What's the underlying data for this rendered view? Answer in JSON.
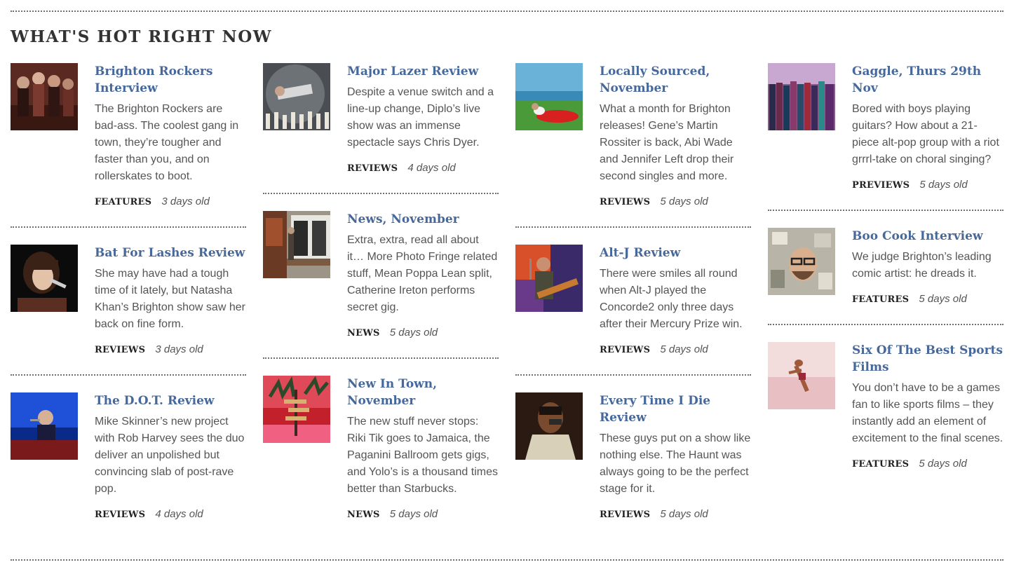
{
  "section_title": "WHAT'S HOT RIGHT NOW",
  "columns": [
    {
      "items": [
        {
          "title": "Brighton Rockers Interview",
          "desc": "The Brighton Rockers are bad-ass. The coolest gang in town, they’re tougher and faster than you, and on rollerskates to boot.",
          "category": "FEATURES",
          "age": "3 days old",
          "thumb": "brighton-rockers"
        },
        {
          "title": "Bat For Lashes Review",
          "desc": "She may have had a tough time of it lately, but Natasha Khan’s Brighton show saw her back on fine form.",
          "category": "REVIEWS",
          "age": "3 days old",
          "thumb": "bat-for-lashes"
        },
        {
          "title": "The D.O.T. Review",
          "desc": "Mike Skinner’s new project with Rob Harvey sees the duo deliver an unpolished but convincing slab of post-rave pop.",
          "category": "REVIEWS",
          "age": "4 days old",
          "thumb": "dot"
        }
      ]
    },
    {
      "items": [
        {
          "title": "Major Lazer Review",
          "desc": "Despite a venue switch and a line-up change, Diplo’s live show was an immense spectacle says Chris Dyer.",
          "category": "REVIEWS",
          "age": "4 days old",
          "thumb": "major-lazer"
        },
        {
          "title": "News, November",
          "desc": "Extra, extra, read all about it… More Photo Fringe related stuff, Mean Poppa Lean split, Catherine Ireton performs secret gig.",
          "category": "NEWS",
          "age": "5 days old",
          "thumb": "news-november"
        },
        {
          "title": "New In Town, November",
          "desc": "The new stuff never stops: Riki Tik goes to Jamaica, the Paganini Ballroom gets gigs, and Yolo’s is a thousand times better than Starbucks.",
          "category": "NEWS",
          "age": "5 days old",
          "thumb": "new-in-town"
        }
      ]
    },
    {
      "items": [
        {
          "title": "Locally Sourced, November",
          "desc": "What a month for Brighton releases! Gene’s Martin Rossiter is back, Abi Wade and Jennifer Left drop their second singles and more.",
          "category": "REVIEWS",
          "age": "5 days old",
          "thumb": "locally-sourced"
        },
        {
          "title": "Alt-J Review",
          "desc": "There were smiles all round when Alt-J played the Concorde2 only three days after their Mercury Prize win.",
          "category": "REVIEWS",
          "age": "5 days old",
          "thumb": "alt-j"
        },
        {
          "title": "Every Time I Die Review",
          "desc": "These guys put on a show like nothing else. The Haunt was always going to be the perfect stage for it.",
          "category": "REVIEWS",
          "age": "5 days old",
          "thumb": "every-time-i-die"
        }
      ]
    },
    {
      "items": [
        {
          "title": "Gaggle, Thurs 29th Nov",
          "desc": "Bored with boys playing guitars? How about a 21-piece alt-pop group with a riot grrrl-take on choral singing?",
          "category": "PREVIEWS",
          "age": "5 days old",
          "thumb": "gaggle"
        },
        {
          "title": "Boo Cook Interview",
          "desc": "We judge Brighton’s leading comic artist: he dreads it.",
          "category": "FEATURES",
          "age": "5 days old",
          "thumb": "boo-cook"
        },
        {
          "title": "Six Of The Best Sports Films",
          "desc": "You don’t have to be a games fan to like sports films – they instantly add an element of excitement to the final scenes.",
          "category": "FEATURES",
          "age": "5 days old",
          "thumb": "sports-films"
        }
      ]
    }
  ]
}
